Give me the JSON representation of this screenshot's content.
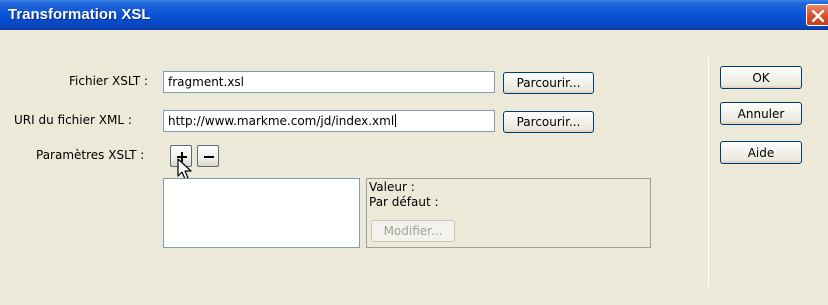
{
  "window": {
    "title": "Transformation XSL",
    "close_icon": "close-icon"
  },
  "form": {
    "xslt_file": {
      "label": "Fichier XSLT :",
      "value": "fragment.xsl",
      "browse_label": "Parcourir..."
    },
    "xml_uri": {
      "label": "URI du fichier XML :",
      "value": "http://www.markme.com/jd/index.xml",
      "browse_label": "Parcourir..."
    },
    "params": {
      "label": "Paramètres XSLT :",
      "add_icon": "plus-icon",
      "remove_icon": "minus-icon",
      "value_label": "Valeur :",
      "default_label": "Par défaut :",
      "modify_label": "Modifier..."
    }
  },
  "buttons": {
    "ok": "OK",
    "cancel": "Annuler",
    "help": "Aide"
  },
  "colors": {
    "titlebar": "#0a57d8",
    "close": "#d8532f",
    "face": "#ece9d8",
    "field_border": "#7f9db9"
  }
}
